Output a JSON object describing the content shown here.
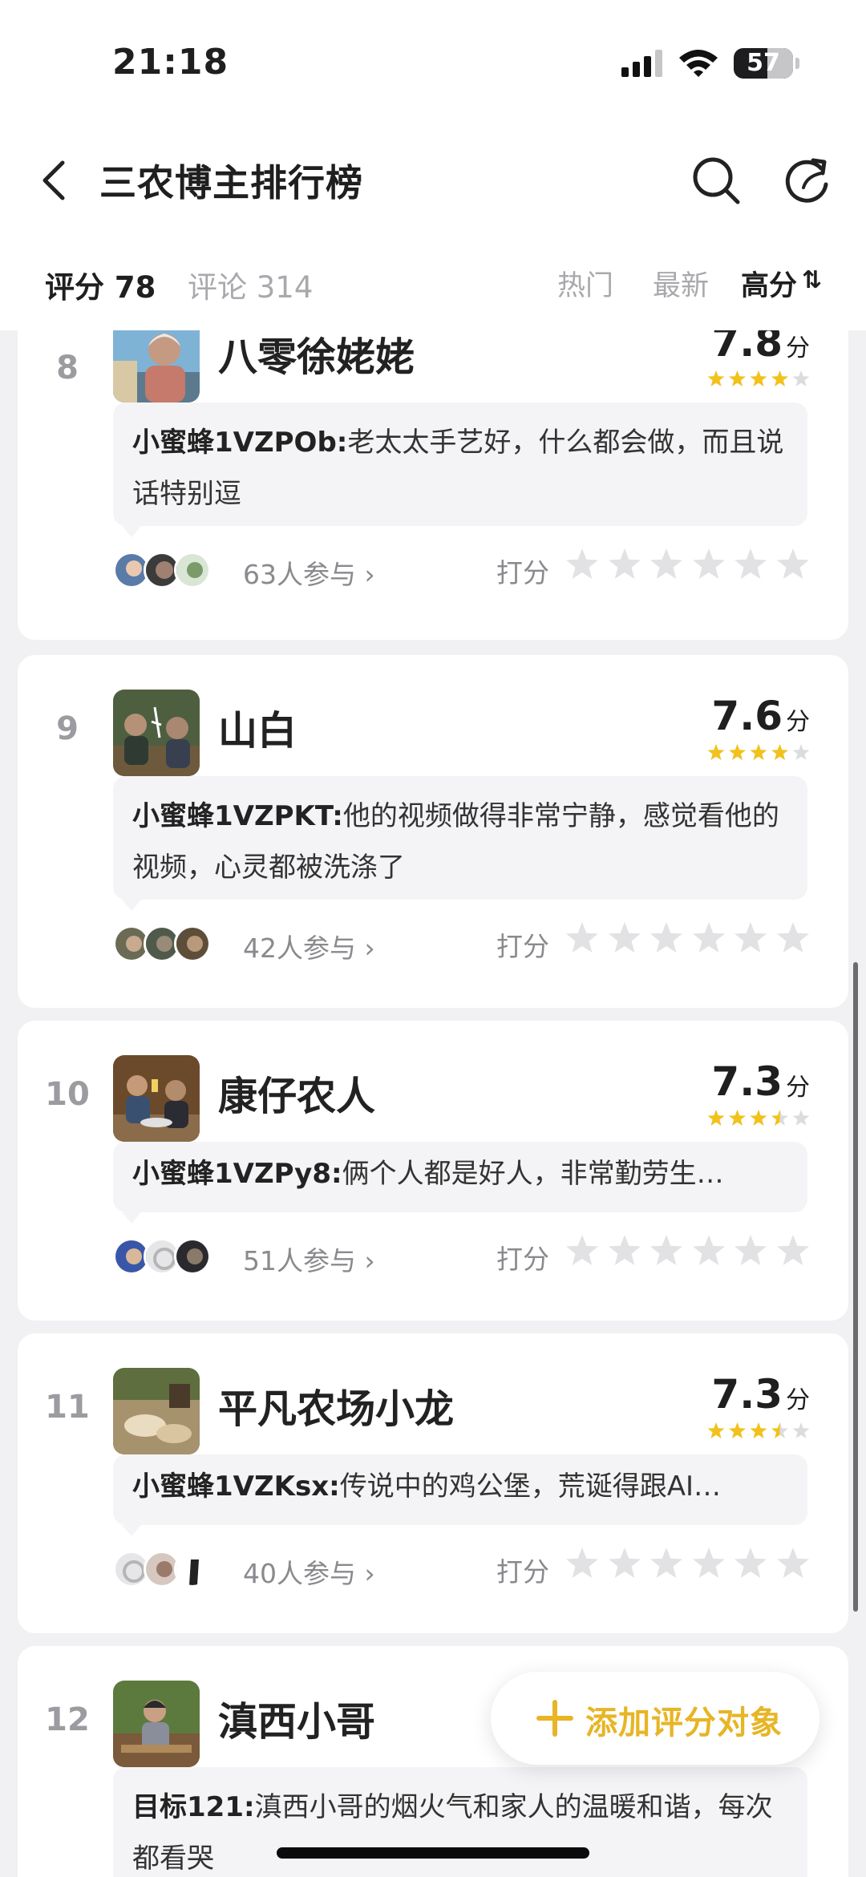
{
  "status_bar": {
    "time": "21:18",
    "battery": "57",
    "battery_fraction": 0.57
  },
  "nav": {
    "title": "三农博主排行榜"
  },
  "tabs": {
    "score": "评分 78",
    "comments": "评论 314"
  },
  "sort": {
    "hot": "热门",
    "new": "最新",
    "high": "高分",
    "high_icon": "⇅"
  },
  "rate_label": "打分",
  "add_button": {
    "label": "添加评分对象"
  },
  "items": [
    {
      "rank": "8",
      "name": "八零徐姥姥",
      "score": "7.8",
      "unit": "分",
      "stars": 4,
      "comment_author": "小蜜蜂1VZPOb:",
      "comment_text": "老太太手艺好，什么都会做，而且说话特别逗",
      "participants": "63人参与",
      "avatar_icon": "elderly-woman-avatar"
    },
    {
      "rank": "9",
      "name": "山白",
      "score": "7.6",
      "unit": "分",
      "stars": 4,
      "comment_author": "小蜜蜂1VZPKT:",
      "comment_text": "他的视频做得非常宁静，感觉看他的视频，心灵都被洗涤了",
      "participants": "42人参与",
      "avatar_icon": "outdoor-group-avatar"
    },
    {
      "rank": "10",
      "name": "康仔农人",
      "score": "7.3",
      "unit": "分",
      "stars": 3.5,
      "comment_author": "小蜜蜂1VZPy8:",
      "comment_text": "俩个人都是好人，非常勤劳生…",
      "participants": "51人参与",
      "avatar_icon": "dinner-toast-avatar"
    },
    {
      "rank": "11",
      "name": "平凡农场小龙",
      "score": "7.3",
      "unit": "分",
      "stars": 3.5,
      "comment_author": "小蜜蜂1VZKsx:",
      "comment_text": "传说中的鸡公堡，荒诞得跟AI…",
      "participants": "40人参与",
      "avatar_icon": "farm-food-avatar"
    },
    {
      "rank": "12",
      "name": "滇西小哥",
      "comment_author": "目标121:",
      "comment_text": "滇西小哥的烟火气和家人的温暖和谐，每次都看哭",
      "avatar_icon": "cooking-woman-avatar"
    }
  ]
}
